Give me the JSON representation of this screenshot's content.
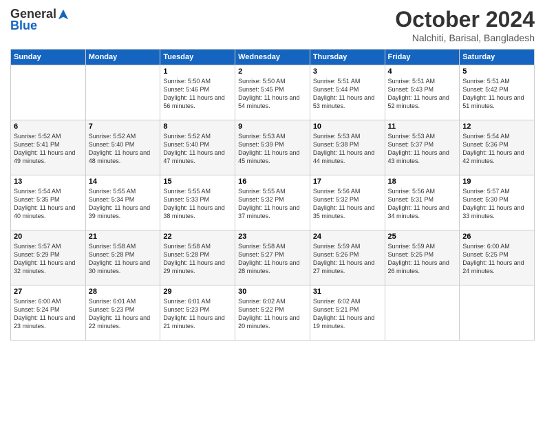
{
  "header": {
    "logo_general": "General",
    "logo_blue": "Blue",
    "month_title": "October 2024",
    "location": "Nalchiti, Barisal, Bangladesh"
  },
  "days_of_week": [
    "Sunday",
    "Monday",
    "Tuesday",
    "Wednesday",
    "Thursday",
    "Friday",
    "Saturday"
  ],
  "weeks": [
    [
      {
        "day": "",
        "info": ""
      },
      {
        "day": "",
        "info": ""
      },
      {
        "day": "1",
        "info": "Sunrise: 5:50 AM\nSunset: 5:46 PM\nDaylight: 11 hours and 56 minutes."
      },
      {
        "day": "2",
        "info": "Sunrise: 5:50 AM\nSunset: 5:45 PM\nDaylight: 11 hours and 54 minutes."
      },
      {
        "day": "3",
        "info": "Sunrise: 5:51 AM\nSunset: 5:44 PM\nDaylight: 11 hours and 53 minutes."
      },
      {
        "day": "4",
        "info": "Sunrise: 5:51 AM\nSunset: 5:43 PM\nDaylight: 11 hours and 52 minutes."
      },
      {
        "day": "5",
        "info": "Sunrise: 5:51 AM\nSunset: 5:42 PM\nDaylight: 11 hours and 51 minutes."
      }
    ],
    [
      {
        "day": "6",
        "info": "Sunrise: 5:52 AM\nSunset: 5:41 PM\nDaylight: 11 hours and 49 minutes."
      },
      {
        "day": "7",
        "info": "Sunrise: 5:52 AM\nSunset: 5:40 PM\nDaylight: 11 hours and 48 minutes."
      },
      {
        "day": "8",
        "info": "Sunrise: 5:52 AM\nSunset: 5:40 PM\nDaylight: 11 hours and 47 minutes."
      },
      {
        "day": "9",
        "info": "Sunrise: 5:53 AM\nSunset: 5:39 PM\nDaylight: 11 hours and 45 minutes."
      },
      {
        "day": "10",
        "info": "Sunrise: 5:53 AM\nSunset: 5:38 PM\nDaylight: 11 hours and 44 minutes."
      },
      {
        "day": "11",
        "info": "Sunrise: 5:53 AM\nSunset: 5:37 PM\nDaylight: 11 hours and 43 minutes."
      },
      {
        "day": "12",
        "info": "Sunrise: 5:54 AM\nSunset: 5:36 PM\nDaylight: 11 hours and 42 minutes."
      }
    ],
    [
      {
        "day": "13",
        "info": "Sunrise: 5:54 AM\nSunset: 5:35 PM\nDaylight: 11 hours and 40 minutes."
      },
      {
        "day": "14",
        "info": "Sunrise: 5:55 AM\nSunset: 5:34 PM\nDaylight: 11 hours and 39 minutes."
      },
      {
        "day": "15",
        "info": "Sunrise: 5:55 AM\nSunset: 5:33 PM\nDaylight: 11 hours and 38 minutes."
      },
      {
        "day": "16",
        "info": "Sunrise: 5:55 AM\nSunset: 5:32 PM\nDaylight: 11 hours and 37 minutes."
      },
      {
        "day": "17",
        "info": "Sunrise: 5:56 AM\nSunset: 5:32 PM\nDaylight: 11 hours and 35 minutes."
      },
      {
        "day": "18",
        "info": "Sunrise: 5:56 AM\nSunset: 5:31 PM\nDaylight: 11 hours and 34 minutes."
      },
      {
        "day": "19",
        "info": "Sunrise: 5:57 AM\nSunset: 5:30 PM\nDaylight: 11 hours and 33 minutes."
      }
    ],
    [
      {
        "day": "20",
        "info": "Sunrise: 5:57 AM\nSunset: 5:29 PM\nDaylight: 11 hours and 32 minutes."
      },
      {
        "day": "21",
        "info": "Sunrise: 5:58 AM\nSunset: 5:28 PM\nDaylight: 11 hours and 30 minutes."
      },
      {
        "day": "22",
        "info": "Sunrise: 5:58 AM\nSunset: 5:28 PM\nDaylight: 11 hours and 29 minutes."
      },
      {
        "day": "23",
        "info": "Sunrise: 5:58 AM\nSunset: 5:27 PM\nDaylight: 11 hours and 28 minutes."
      },
      {
        "day": "24",
        "info": "Sunrise: 5:59 AM\nSunset: 5:26 PM\nDaylight: 11 hours and 27 minutes."
      },
      {
        "day": "25",
        "info": "Sunrise: 5:59 AM\nSunset: 5:25 PM\nDaylight: 11 hours and 26 minutes."
      },
      {
        "day": "26",
        "info": "Sunrise: 6:00 AM\nSunset: 5:25 PM\nDaylight: 11 hours and 24 minutes."
      }
    ],
    [
      {
        "day": "27",
        "info": "Sunrise: 6:00 AM\nSunset: 5:24 PM\nDaylight: 11 hours and 23 minutes."
      },
      {
        "day": "28",
        "info": "Sunrise: 6:01 AM\nSunset: 5:23 PM\nDaylight: 11 hours and 22 minutes."
      },
      {
        "day": "29",
        "info": "Sunrise: 6:01 AM\nSunset: 5:23 PM\nDaylight: 11 hours and 21 minutes."
      },
      {
        "day": "30",
        "info": "Sunrise: 6:02 AM\nSunset: 5:22 PM\nDaylight: 11 hours and 20 minutes."
      },
      {
        "day": "31",
        "info": "Sunrise: 6:02 AM\nSunset: 5:21 PM\nDaylight: 11 hours and 19 minutes."
      },
      {
        "day": "",
        "info": ""
      },
      {
        "day": "",
        "info": ""
      }
    ]
  ]
}
